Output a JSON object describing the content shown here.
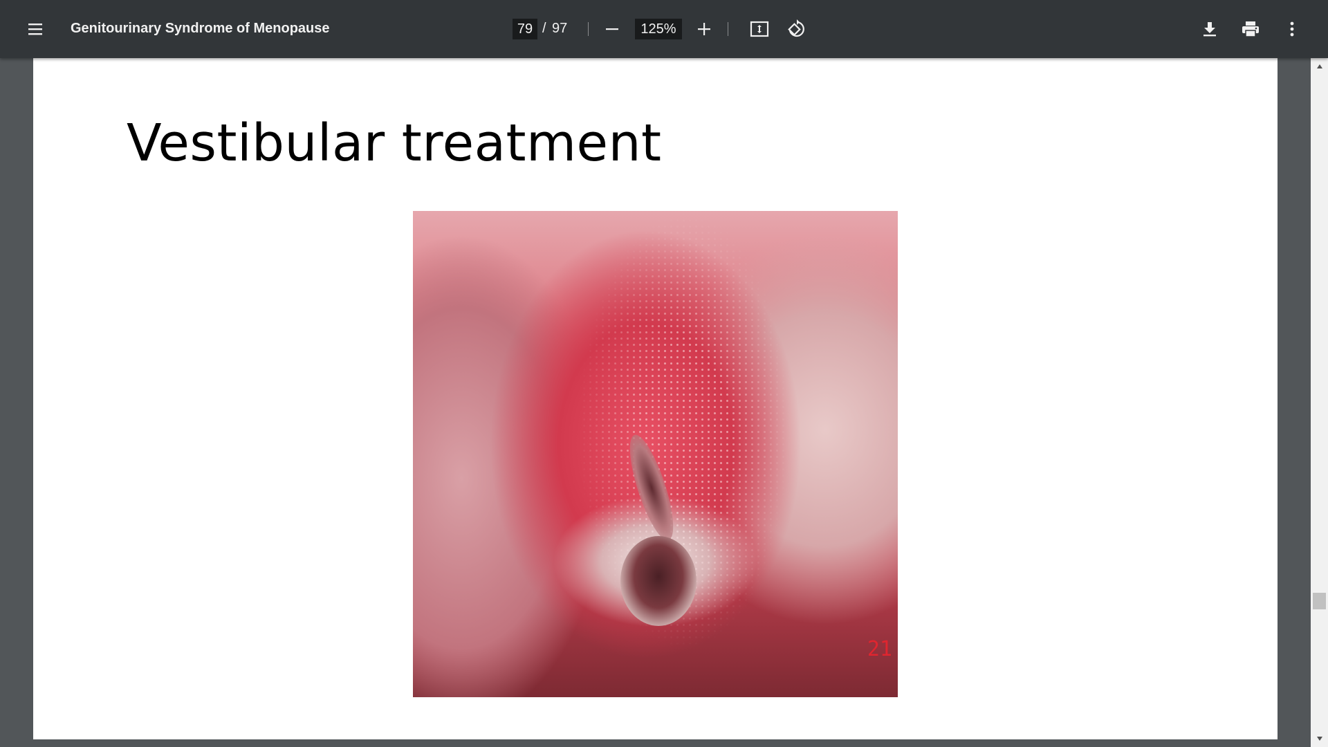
{
  "toolbar": {
    "menu_icon": "menu-icon",
    "title": "Genitourinary Syndrome of Menopause",
    "page_current": "79",
    "page_separator": "/",
    "page_total": "97",
    "zoom": "125%",
    "icons": {
      "zoom_out": "minus-icon",
      "zoom_in": "plus-icon",
      "fit": "fit-to-page-icon",
      "rotate": "rotate-icon",
      "download": "download-icon",
      "print": "print-icon",
      "more": "more-vert-icon"
    }
  },
  "slide": {
    "title": "Vestibular treatment",
    "photo_label": "21"
  },
  "colors": {
    "toolbar_bg": "#323639",
    "viewer_bg": "#525659",
    "page_bg": "#ffffff",
    "photo_label": "#e0252f"
  }
}
